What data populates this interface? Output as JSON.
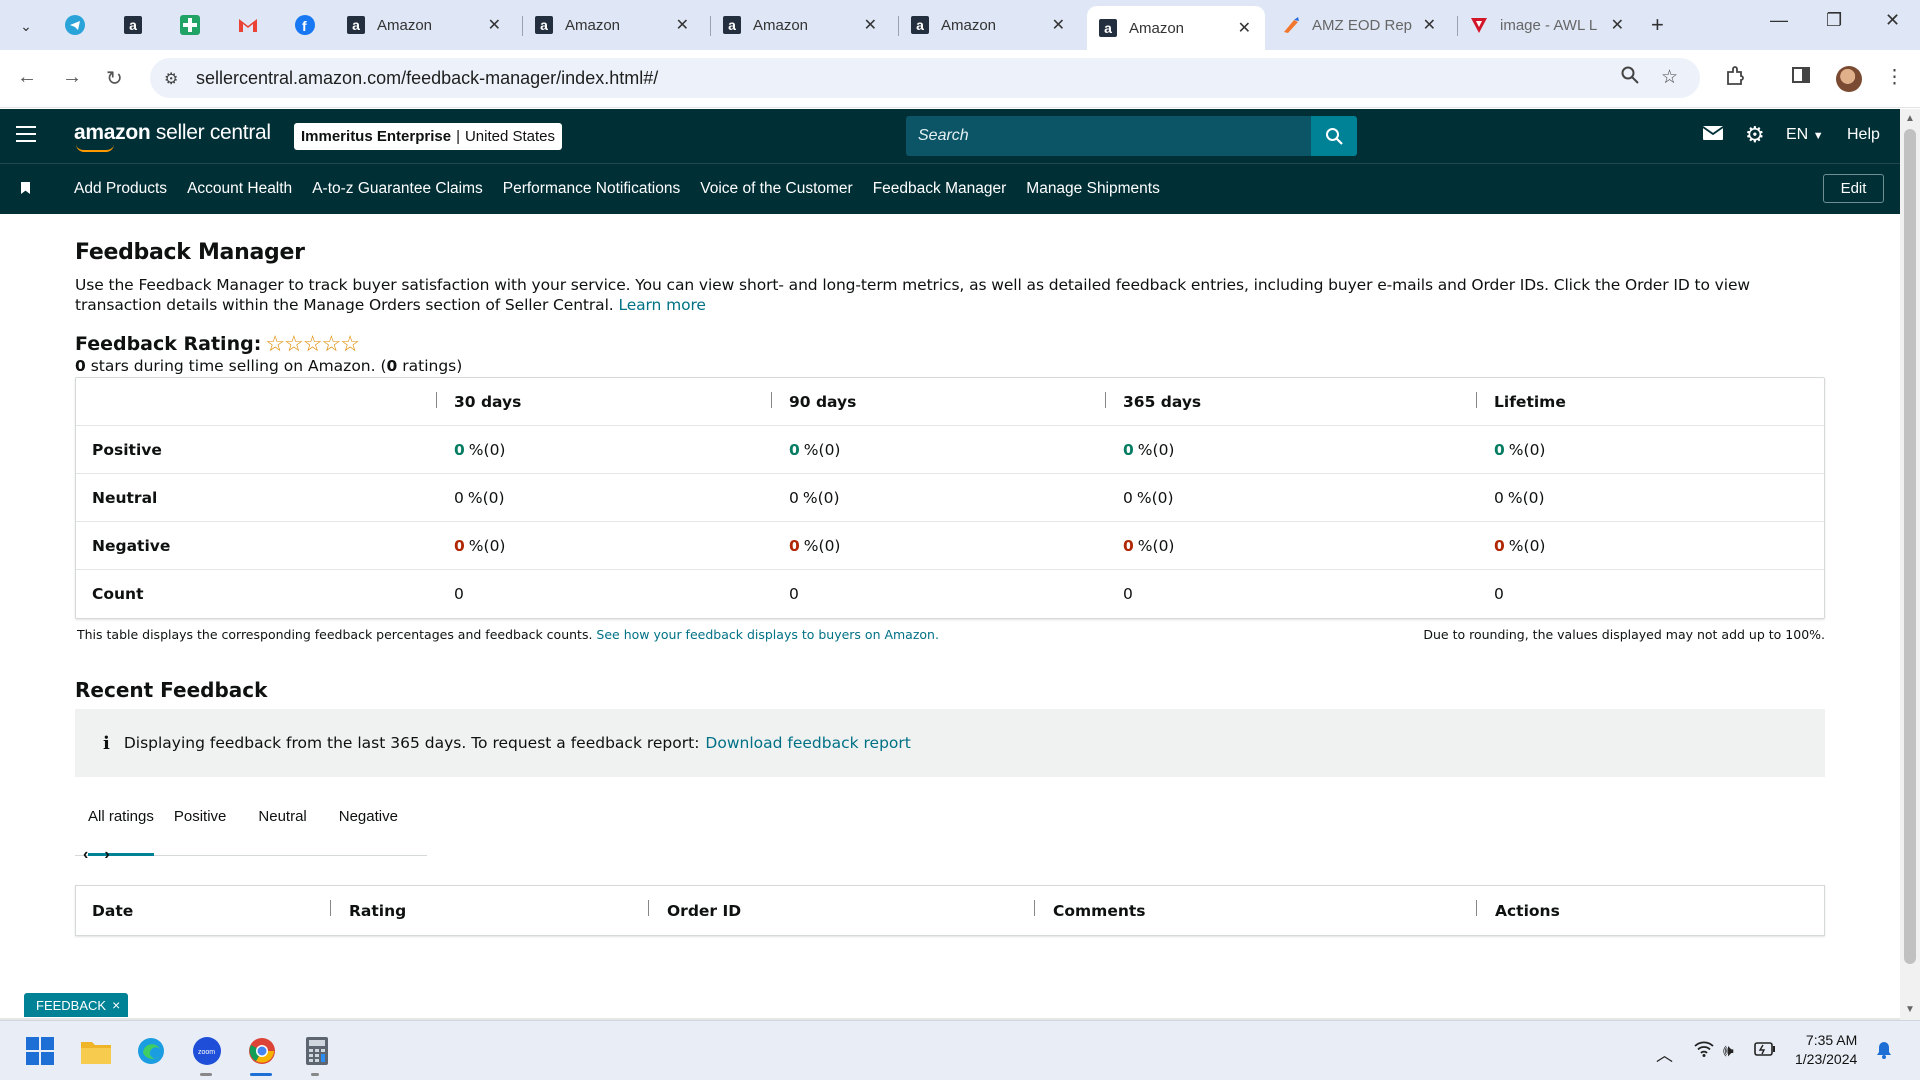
{
  "browser": {
    "tabs": [
      {
        "title": "Amazon",
        "favicon": "amazon-a-icon",
        "active": false
      },
      {
        "title": "Amazon",
        "favicon": "amazon-a-icon",
        "active": false
      },
      {
        "title": "Amazon",
        "favicon": "amazon-a-icon",
        "active": false
      },
      {
        "title": "Amazon",
        "favicon": "amazon-a-icon",
        "active": false
      },
      {
        "title": "Amazon",
        "favicon": "amazon-a-icon",
        "active": true
      },
      {
        "title": "AMZ EOD Rep",
        "favicon": "brush-icon",
        "active": false
      },
      {
        "title": "image - AWL L",
        "favicon": "awl-icon",
        "active": false
      }
    ],
    "url": "sellercentral.amazon.com/feedback-manager/index.html#/"
  },
  "header": {
    "logo_bold": "amazon",
    "logo_rest": " seller central",
    "store_name": "Immeritus Enterprise",
    "store_sep": "|",
    "store_region": "United States",
    "search_placeholder": "Search",
    "language": "EN",
    "help": "Help"
  },
  "nav": {
    "links": [
      "Add Products",
      "Account Health",
      "A-to-z Guarantee Claims",
      "Performance Notifications",
      "Voice of the Customer",
      "Feedback Manager",
      "Manage Shipments"
    ],
    "edit": "Edit"
  },
  "page": {
    "title": "Feedback Manager",
    "intro": "Use the Feedback Manager to track buyer satisfaction with your service. You can view short- and long-term metrics, as well as detailed feedback entries, including buyer e-mails and Order IDs. Click the Order ID to view transaction details within the Manage Orders section of Seller Central.",
    "learn_more": "Learn more",
    "rating_label": "Feedback Rating:",
    "stars": "☆☆☆☆☆",
    "rating_value": 0,
    "rating_stars_count": "0",
    "rating_sub_mid": " stars during time selling on Amazon. (",
    "rating_count": "0",
    "rating_sub_end": " ratings)"
  },
  "metrics": {
    "columns": [
      "30 days",
      "90 days",
      "365 days",
      "Lifetime"
    ],
    "rows": {
      "positive": {
        "label": "Positive",
        "values": [
          "0",
          "0",
          "0",
          "0"
        ],
        "suffix": "%(0)"
      },
      "neutral": {
        "label": "Neutral",
        "values": [
          "0",
          "0",
          "0",
          "0"
        ],
        "suffix": "%(0)"
      },
      "negative": {
        "label": "Negative",
        "values": [
          "0",
          "0",
          "0",
          "0"
        ],
        "suffix": "%(0)"
      },
      "count": {
        "label": "Count",
        "values": [
          "0",
          "0",
          "0",
          "0"
        ]
      }
    },
    "note_left": "This table displays the corresponding feedback percentages and feedback counts.",
    "note_link": "See how your feedback displays to buyers on Amazon.",
    "note_right": "Due to rounding, the values displayed may not add up to 100%."
  },
  "recent": {
    "title": "Recent Feedback",
    "info_icon": "i",
    "info_text": "Displaying feedback from the last 365 days. To request a feedback report:",
    "info_link": "Download feedback report",
    "tabs": [
      "All ratings",
      "Positive",
      "Neutral",
      "Negative"
    ],
    "prev": "‹",
    "next": "›",
    "table_headers": [
      "Date",
      "Rating",
      "Order ID",
      "Comments",
      "Actions"
    ]
  },
  "feedback_pill": {
    "label": "FEEDBACK",
    "close": "×"
  },
  "taskbar": {
    "time": "7:35 AM",
    "date": "1/23/2024"
  },
  "colors": {
    "header_bg": "#002f36",
    "search_btn": "#008296",
    "positive": "#067d62",
    "negative": "#b12704",
    "link": "#007185",
    "star": "#de8b00"
  }
}
